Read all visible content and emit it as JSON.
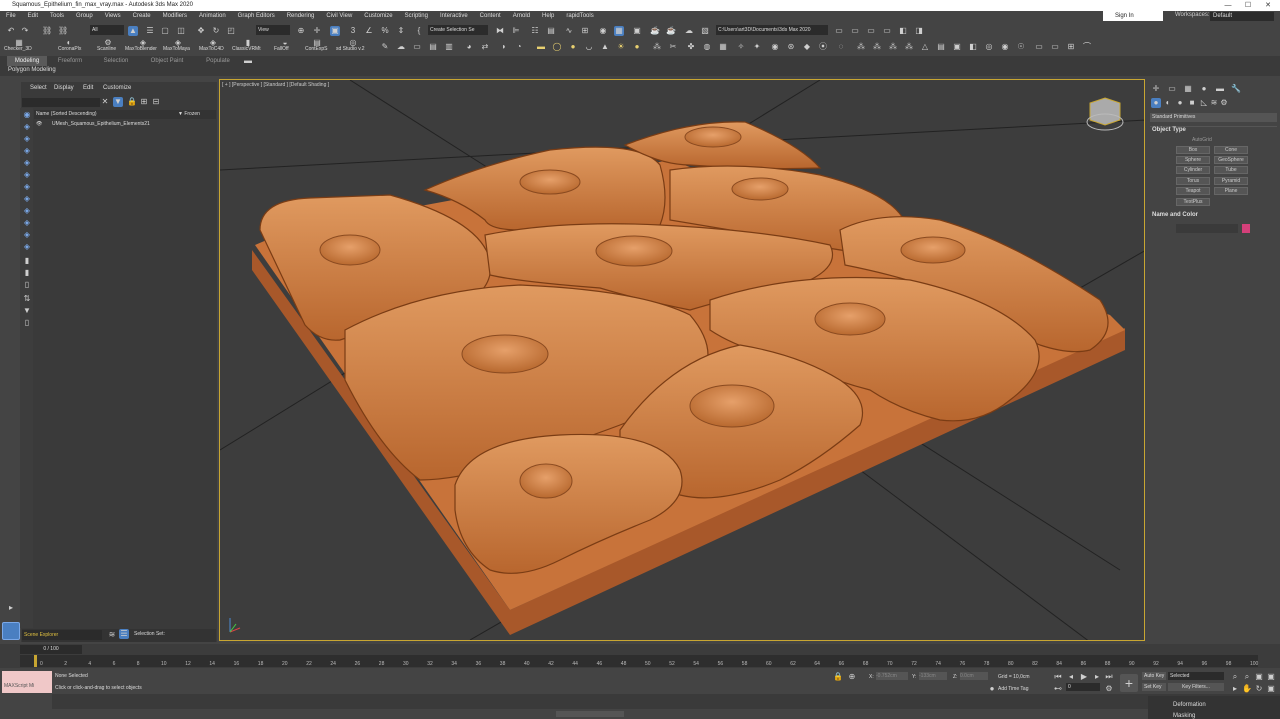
{
  "app": {
    "title": "Squamous_Epithelium_fin_max_vray.max - Autodesk 3ds Max 2020"
  },
  "menu": [
    "File",
    "Edit",
    "Tools",
    "Group",
    "Views",
    "Create",
    "Modifiers",
    "Animation",
    "Graph Editors",
    "Rendering",
    "Civil View",
    "Customize",
    "Scripting",
    "Interactive",
    "Content",
    "Arnold",
    "Help",
    "rapidTools"
  ],
  "account": {
    "signin": "Sign In",
    "workspaces_label": "Workspaces:",
    "workspace": "Default"
  },
  "toolbar": {
    "filter": "All",
    "view": "View",
    "selection_set": "Create Selection Se",
    "path": "C:\\Users\\art3D\\Documents\\3ds Max 2020"
  },
  "shelf": [
    "Checker_3D",
    "CoronaPlx",
    "Scanline",
    "MaxToBlender",
    "MaxToMaya",
    "MaxToC4D",
    "ClassicVRMt",
    "FallOff",
    "ContExpS",
    "sd Studio v.2"
  ],
  "ribbon": {
    "tabs": [
      "Modeling",
      "Freeform",
      "Selection",
      "Object Paint",
      "Populate"
    ],
    "panel": "Polygon Modeling"
  },
  "explorer": {
    "tabs": [
      "Select",
      "Display",
      "Edit",
      "Customize"
    ],
    "col_name": "Name (Sorted Descending)",
    "col_frozen": "▼ Frozen",
    "object": "UMesh_Squamous_Epithelium_Elements21",
    "scene_explorer": "Scene Explorer",
    "selection_set": "Selection Set:"
  },
  "viewport": {
    "label": "[ + ] [Perspective ] [Standard ] [Default Shading ]"
  },
  "command_panel": {
    "dropdown": "Standard Primitives",
    "object_type": "Object Type",
    "autogrid": "AutoGrid",
    "primitives": [
      "Box",
      "Cone",
      "Sphere",
      "GeoSphere",
      "Cylinder",
      "Tube",
      "Torus",
      "Pyramid",
      "Teapot",
      "Plane",
      "TextPlus"
    ],
    "name_color": "Name and Color",
    "color": "#d4407a"
  },
  "timeline": {
    "frame": "0 / 100",
    "ticks": [
      "0",
      "2",
      "4",
      "6",
      "8",
      "10",
      "12",
      "14",
      "16",
      "18",
      "20",
      "22",
      "24",
      "26",
      "28",
      "30",
      "32",
      "34",
      "36",
      "38",
      "40",
      "42",
      "44",
      "46",
      "48",
      "50",
      "52",
      "54",
      "56",
      "58",
      "60",
      "62",
      "64",
      "66",
      "68",
      "70",
      "72",
      "74",
      "76",
      "78",
      "80",
      "82",
      "84",
      "86",
      "88",
      "90",
      "92",
      "94",
      "96",
      "98",
      "100"
    ]
  },
  "status": {
    "maxscript": "MAXScript Mi",
    "selection": "None Selected",
    "hint": "Click or click-and-drag to select objects",
    "x_label": "X:",
    "x": "-0.752cm",
    "y_label": "Y:",
    "y": "-133cm",
    "z_label": "Z:",
    "z": "0.0cm",
    "grid": "Grid = 10,0cm",
    "add_time_tag": "Add Time Tag",
    "auto_key": "Auto Key",
    "set_key": "Set Key",
    "selected": "Selected",
    "key_filters": "Key Filters...",
    "frame_num": "0",
    "deformation": "Deformation",
    "masking": "Masking"
  },
  "colors": {
    "accent": "#c8a632",
    "cell": "#c8733a",
    "viewport_bg": "#3d3d3d"
  }
}
